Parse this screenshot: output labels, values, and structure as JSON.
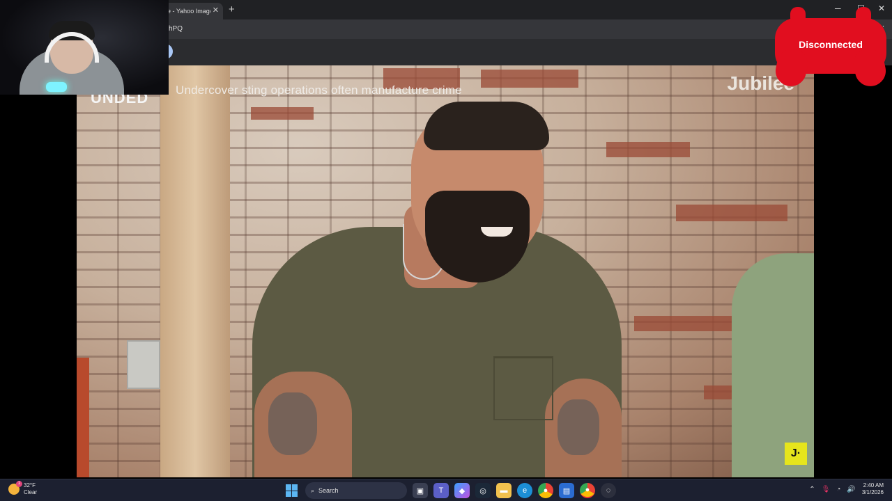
{
  "browser": {
    "tab_title": "e - Yahoo Image",
    "tab_close": "✕",
    "new_tab": "+",
    "address_text": "hPQ",
    "window_controls": [
      "─",
      "☐",
      "✕"
    ]
  },
  "video": {
    "caption": "Undercover sting operations often manufacture crime",
    "corner_text": "UNDED",
    "brand": "Jubilee",
    "brand_logo": "J·"
  },
  "overlay": {
    "status": "Disconnected",
    "status_color": "#e10e1f"
  },
  "taskbar": {
    "weather_temp": "32°F",
    "weather_desc": "Clear",
    "weather_badge": "1",
    "search_label": "Search",
    "icons": [
      "start-icon",
      "search-icon",
      "task-view-icon",
      "teams-icon",
      "copilot-icon",
      "steam-icon",
      "file-explorer-icon",
      "edge-icon",
      "chrome-icon",
      "store-icon",
      "chrome-active-icon",
      "app-icon"
    ],
    "time": "2:40 AM",
    "date": "3/1/2026"
  }
}
